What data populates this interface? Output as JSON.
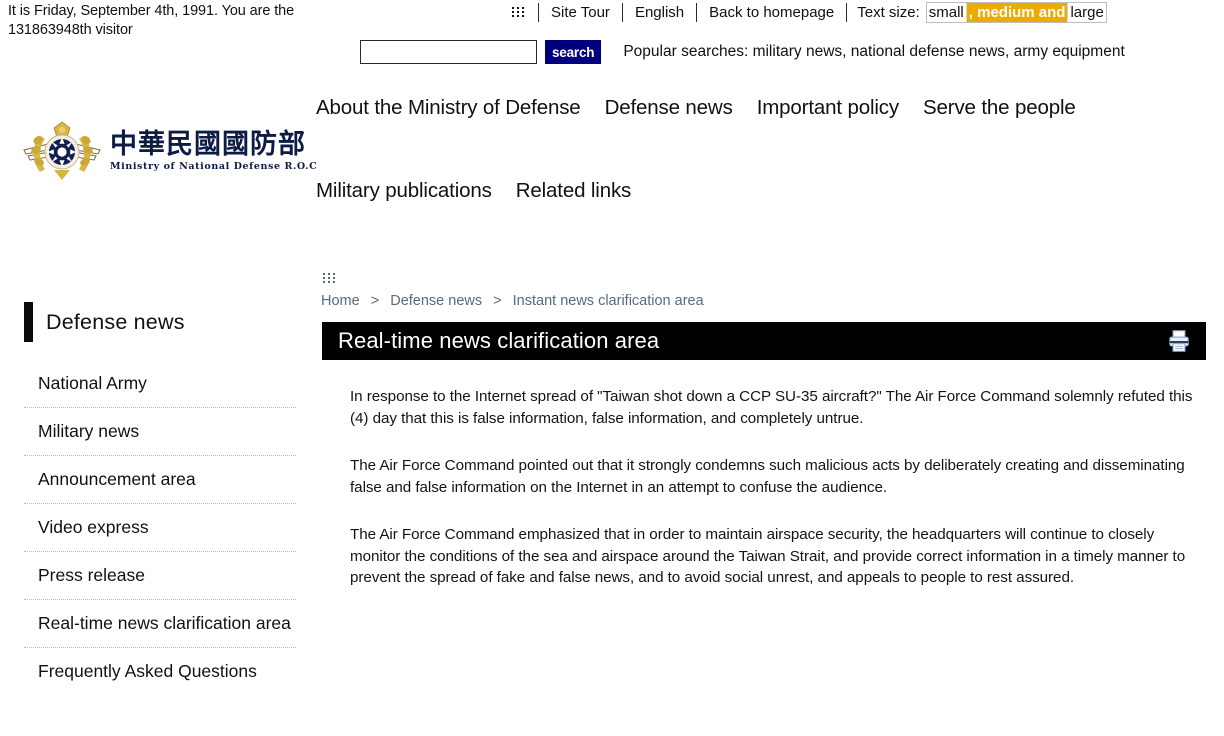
{
  "visitor_note": "It is Friday, September 4th, 1991. You are the 131863948th visitor",
  "topbar": {
    "accessibility_anchor": ":::",
    "links": [
      {
        "label": "Site Tour"
      },
      {
        "label": "English"
      },
      {
        "label": "Back to homepage"
      }
    ],
    "text_size": {
      "label": "Text size:",
      "options": [
        {
          "label": "small",
          "active": false
        },
        {
          "label": ", medium and",
          "active": true
        },
        {
          "label": "large",
          "active": false
        }
      ],
      "active_color": "#edab00"
    }
  },
  "search": {
    "value": "",
    "placeholder": "",
    "button_label": "search",
    "button_color": "#00007f",
    "popular_searches": "Popular searches: military news, national defense news, army equipment"
  },
  "logo": {
    "chinese_name": "中華民國國防部",
    "english_name": "Ministry  of  National  Defense  R.O.C",
    "brand_color": "#0d1b45",
    "emblem_gold": "#d8b645"
  },
  "mainnav": {
    "row1": [
      {
        "label": "About the Ministry of Defense"
      },
      {
        "label": "Defense news"
      },
      {
        "label": "Important policy"
      },
      {
        "label": "Serve the people"
      }
    ],
    "row2": [
      {
        "label": "Military publications"
      },
      {
        "label": "Related links"
      }
    ]
  },
  "breadcrumb": {
    "accessibility_anchor": ":::",
    "items": [
      {
        "label": "Home"
      },
      {
        "label": "Defense news"
      },
      {
        "label": "Instant news clarification area"
      }
    ],
    "separator": ">"
  },
  "sidebar": {
    "heading": "Defense news",
    "items": [
      {
        "label": "National Army"
      },
      {
        "label": "Military news"
      },
      {
        "label": "Announcement area"
      },
      {
        "label": "Video express"
      },
      {
        "label": "Press release"
      },
      {
        "label": "Real-time news clarification area"
      },
      {
        "label": "Frequently Asked Questions"
      }
    ]
  },
  "content": {
    "title": "Real-time news clarification area",
    "print_icon": "printer-icon",
    "paragraphs": [
      "In response to the Internet spread of \"Taiwan shot down a CCP SU-35 aircraft?\" The Air Force Command solemnly refuted this (4) day that this is false information, false information, and completely untrue.",
      "The Air Force Command pointed out that it strongly condemns such malicious acts by deliberately creating and disseminating false and false information on the Internet in an attempt to confuse the audience.",
      "The Air Force Command emphasized that in order to maintain airspace security, the headquarters will continue to closely monitor the conditions of the sea and airspace around the Taiwan Strait, and provide correct information in a timely manner to prevent the spread of fake and false news, and to avoid social unrest, and appeals to people to rest assured."
    ]
  }
}
